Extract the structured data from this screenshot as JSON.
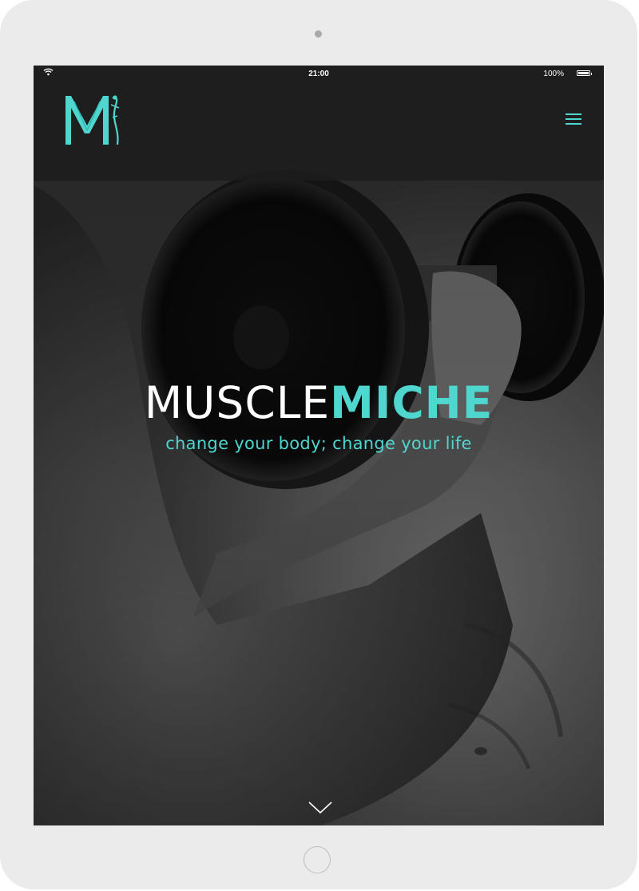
{
  "status_bar": {
    "time": "21:00",
    "battery_percent": "100%",
    "battery_level": 1.0,
    "wifi": "wifi-icon"
  },
  "nav": {
    "logo_letter": "M",
    "menu_icon": "hamburger-menu-icon"
  },
  "hero": {
    "title_part1": "MUSCLE",
    "title_part2": "MICHE",
    "tagline": "change your body; change your life",
    "background": "black-and-white photo of a person lifting a dumbbell",
    "scroll_icon": "chevron-down-icon"
  },
  "colors": {
    "accent": "#4fd6cf",
    "nav_bg": "#1c1c1c",
    "device_frame": "#ebebeb"
  }
}
